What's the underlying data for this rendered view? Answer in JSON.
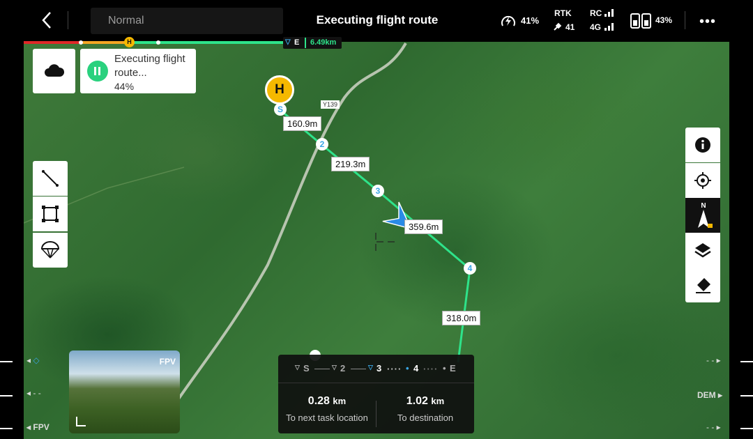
{
  "topbar": {
    "mode_label": "Normal",
    "title": "Executing flight route",
    "battery_percent": "41%",
    "rtk_label": "RTK",
    "rtk_count": "41",
    "rc_label": "RC",
    "net_label": "4G",
    "rc_battery_percent": "43%"
  },
  "route_progress": {
    "home_marker": "H",
    "end_marker": "E",
    "remaining_distance": "6.49km"
  },
  "status_card": {
    "text": "Executing flight route...",
    "percent": "44%",
    "progress": 0.44
  },
  "map": {
    "home_marker": "H",
    "start_marker": "S",
    "road_label": "Y139",
    "waypoints": [
      "2",
      "3",
      "4"
    ],
    "segment_distances": [
      "160.9m",
      "219.3m",
      "359.6m",
      "318.0m"
    ],
    "route_color": "#2ee38a"
  },
  "fpv": {
    "label": "FPV"
  },
  "bottom_panel": {
    "route_steps": [
      "S",
      "2",
      "3",
      "4",
      "E"
    ],
    "current_step": "3",
    "next_task_value": "0.28",
    "next_task_unit": "km",
    "next_task_label": "To next task location",
    "destination_value": "1.02",
    "destination_unit": "km",
    "destination_label": "To destination"
  },
  "edge_labels": {
    "left_bottom": "FPV",
    "left_mid": "- -",
    "right_mid": "DEM",
    "right_top": "- -",
    "right_bottom": "- -"
  },
  "icons": {
    "back": "back-icon",
    "cloud": "cloud-icon",
    "line": "line-tool-icon",
    "area": "area-tool-icon",
    "parachute": "parachute-icon",
    "info": "info-icon",
    "locate": "locate-icon",
    "compass": "compass-icon",
    "layers": "layers-icon",
    "eraser": "eraser-icon"
  },
  "colors": {
    "accent_green": "#2ad17e",
    "home_yellow": "#f5b800",
    "waypoint_blue": "#3aa7e6"
  }
}
